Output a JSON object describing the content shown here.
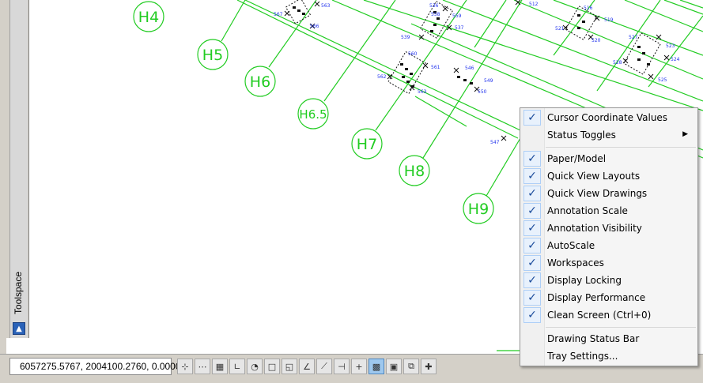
{
  "drawing": {
    "grid_labels": [
      "H4",
      "H5",
      "H6",
      "H6.5",
      "H7",
      "H8",
      "H9"
    ],
    "pile_labels": [
      "567",
      "563",
      "566",
      "536",
      "539",
      "537",
      "560",
      "558",
      "559",
      "561",
      "562",
      "563",
      "546",
      "549",
      "550",
      "512",
      "516",
      "519",
      "520",
      "521",
      "527",
      "523",
      "524",
      "525",
      "528",
      "547"
    ]
  },
  "toolspace": {
    "title": "Toolspace",
    "button_icon": "palette-menu-icon"
  },
  "statusbar": {
    "coordinates": "6057275.5767, 2004100.2760, 0.0000",
    "toggles": [
      {
        "name": "infer-constraints-toggle",
        "icon": "⊹",
        "on": false
      },
      {
        "name": "snap-mode-toggle",
        "icon": "⋯",
        "on": false
      },
      {
        "name": "grid-display-toggle",
        "icon": "▦",
        "on": false
      },
      {
        "name": "ortho-mode-toggle",
        "icon": "∟",
        "on": false
      },
      {
        "name": "polar-tracking-toggle",
        "icon": "◔",
        "on": false
      },
      {
        "name": "object-snap-toggle",
        "icon": "□",
        "on": false
      },
      {
        "name": "3d-object-snap-toggle",
        "icon": "◱",
        "on": false
      },
      {
        "name": "object-snap-tracking-toggle",
        "icon": "∠",
        "on": false
      },
      {
        "name": "dynamic-ucs-toggle",
        "icon": "⟋",
        "on": false
      },
      {
        "name": "dynamic-input-toggle",
        "icon": "⊣",
        "on": false
      },
      {
        "name": "lineweight-toggle",
        "icon": "+",
        "on": false
      },
      {
        "name": "transparency-toggle",
        "icon": "▩",
        "on": true
      },
      {
        "name": "quick-properties-toggle",
        "icon": "▣",
        "on": false
      },
      {
        "name": "selection-cycling-toggle",
        "icon": "⧉",
        "on": false
      },
      {
        "name": "annotation-monitor-toggle",
        "icon": "✚",
        "on": false
      }
    ]
  },
  "menu": {
    "items": [
      {
        "label": "Cursor Coordinate Values",
        "checked": true
      },
      {
        "label": "Status Toggles",
        "checked": false,
        "submenu": true
      },
      {
        "separator": true
      },
      {
        "label": "Paper/Model",
        "checked": true
      },
      {
        "label": "Quick View Layouts",
        "checked": true
      },
      {
        "label": "Quick View Drawings",
        "checked": true
      },
      {
        "label": "Annotation Scale",
        "checked": true
      },
      {
        "label": "Annotation Visibility",
        "checked": true
      },
      {
        "label": "AutoScale",
        "checked": true
      },
      {
        "label": "Workspaces",
        "checked": true
      },
      {
        "label": "Display Locking",
        "checked": true
      },
      {
        "label": "Display Performance",
        "checked": true
      },
      {
        "label": "Clean Screen (Ctrl+0)",
        "checked": true
      },
      {
        "separator": true
      },
      {
        "label": "Drawing Status Bar",
        "checked": false
      },
      {
        "label": "Tray Settings...",
        "checked": false
      }
    ],
    "check_glyph": "✓",
    "submenu_arrow": "▶"
  },
  "colors": {
    "grid": "#22cc22",
    "pile_text": "#2233ee",
    "menu_check": "#1a4b9b",
    "toggle_on": "#9ec8ee"
  }
}
